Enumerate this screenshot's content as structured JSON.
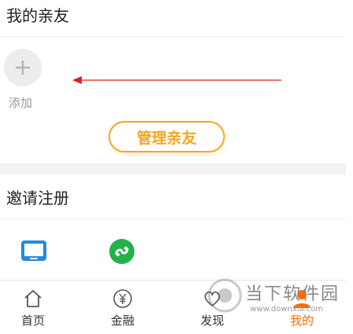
{
  "friends_section": {
    "title": "我的亲友",
    "add_label": "添加",
    "manage_button": "管理亲友"
  },
  "invite_section": {
    "title": "邀请注册",
    "apps": [
      {
        "icon": "tablet-icon",
        "label": "…"
      },
      {
        "icon": "mini-program-icon",
        "label": "…"
      }
    ]
  },
  "tabbar": {
    "items": [
      {
        "label": "首页",
        "icon": "home-icon"
      },
      {
        "label": "金融",
        "icon": "yuan-icon"
      },
      {
        "label": "发现",
        "icon": "heart-icon"
      },
      {
        "label": "我的",
        "icon": "person-icon",
        "active": true
      }
    ]
  },
  "watermark": {
    "text": "当下软件园",
    "url": "www.downxia.com"
  },
  "colors": {
    "accent": "#f5a623",
    "active_tab": "#ff6a00",
    "arrow": "#e0201c"
  }
}
